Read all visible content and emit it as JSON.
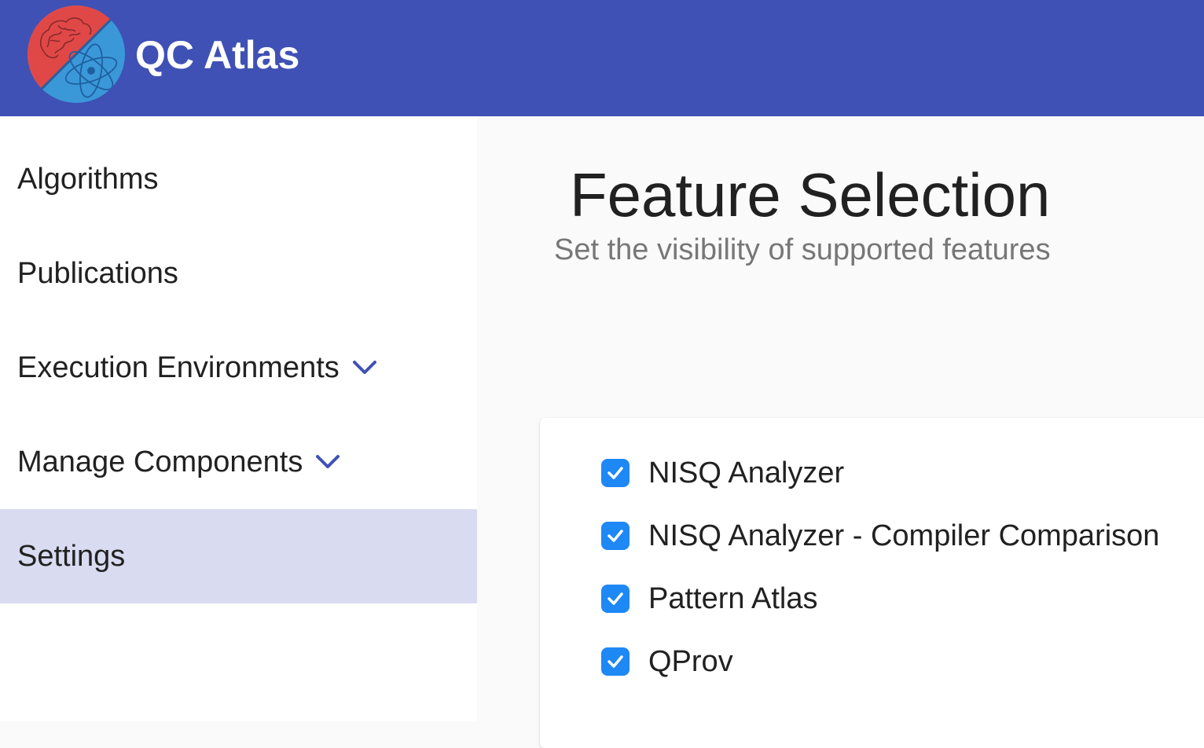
{
  "header": {
    "app_title": "QC Atlas",
    "logo_icon": "brain-atom-logo-icon",
    "background_color": "#3f51b5"
  },
  "sidebar": {
    "items": [
      {
        "label": "Algorithms",
        "expandable": false,
        "active": false
      },
      {
        "label": "Publications",
        "expandable": false,
        "active": false
      },
      {
        "label": "Execution Environments",
        "expandable": true,
        "active": false,
        "icon": "chevron-down-icon"
      },
      {
        "label": "Manage Components",
        "expandable": true,
        "active": false,
        "icon": "chevron-down-icon"
      },
      {
        "label": "Settings",
        "expandable": false,
        "active": true
      }
    ],
    "active_color": "#d9dbf1",
    "chevron_color": "#3f51b5"
  },
  "main": {
    "title": "Feature Selection",
    "subtitle": "Set the visibility of supported features",
    "features": [
      {
        "label": "NISQ Analyzer",
        "checked": true
      },
      {
        "label": "NISQ Analyzer - Compiler Comparison",
        "checked": true
      },
      {
        "label": "Pattern Atlas",
        "checked": true
      },
      {
        "label": "QProv",
        "checked": true
      }
    ],
    "checkbox_color": "#1e88f5"
  }
}
